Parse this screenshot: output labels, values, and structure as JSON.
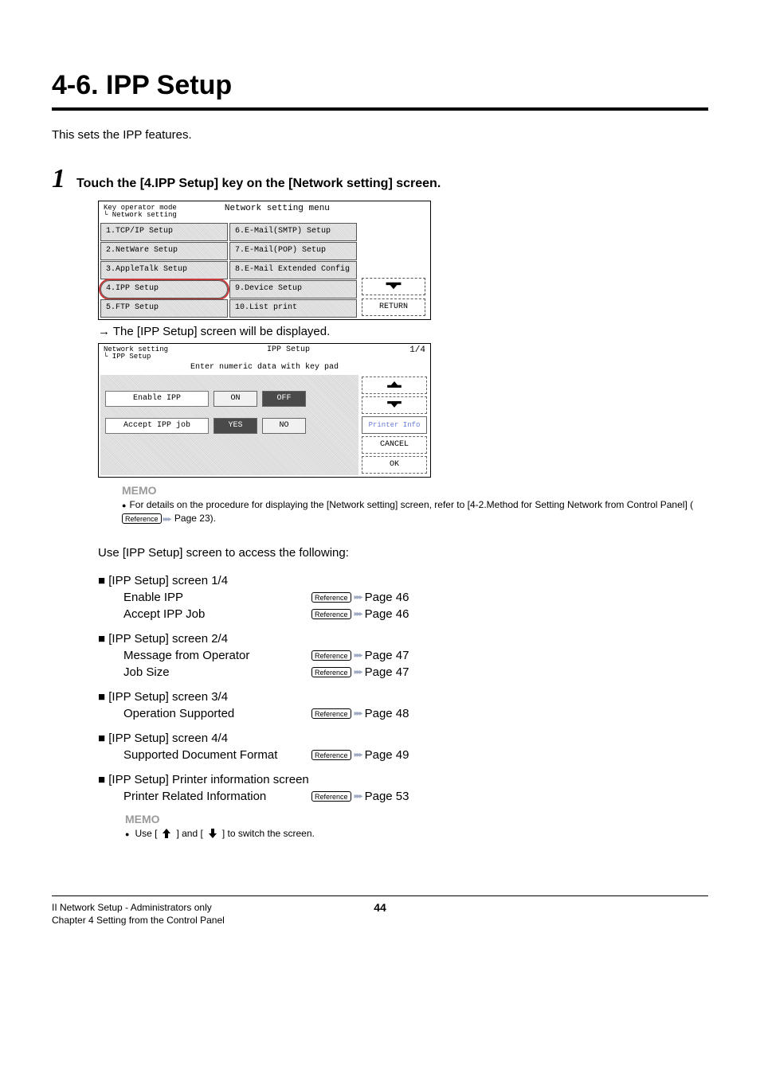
{
  "page": {
    "title": "4-6. IPP Setup",
    "intro": "This sets the IPP features.",
    "step1_num": "1",
    "step1_text": "Touch the [4.IPP Setup] key on the [Network setting] screen."
  },
  "panel1": {
    "breadcrumb1": "Key operator mode",
    "breadcrumb2": "└ Network setting",
    "title": "Network setting menu",
    "left": [
      "1.TCP/IP Setup",
      "2.NetWare Setup",
      "3.AppleTalk Setup",
      "4.IPP Setup",
      "5.FTP Setup"
    ],
    "right": [
      "6.E-Mail(SMTP) Setup",
      "7.E-Mail(POP) Setup",
      "8.E-Mail Extended Config",
      "9.Device Setup",
      "10.List print"
    ],
    "selected_index": 3,
    "return": "RETURN"
  },
  "result_line": "→ The [IPP Setup] screen will be displayed.",
  "panel2": {
    "breadcrumb1": "Network setting",
    "breadcrumb2": "└ IPP Setup",
    "title": "IPP Setup",
    "subtitle": "Enter numeric data with key pad",
    "page_ind": "1/4",
    "row1_label": "Enable IPP",
    "row1_on": "ON",
    "row1_off": "OFF",
    "row2_label": "Accept IPP job",
    "row2_yes": "YES",
    "row2_no": "NO",
    "printer_info": "Printer Info",
    "cancel": "CANCEL",
    "ok": "OK"
  },
  "memo1": {
    "heading": "MEMO",
    "text_a": "For details on the procedure for displaying the [Network setting] screen, refer to [4-2.Method for Setting Network from Control Panel] (",
    "ref": "Reference",
    "text_b": " Page 23)."
  },
  "use_text": "Use [IPP Setup] screen to access the following:",
  "groups": [
    {
      "heading": "[IPP Setup] screen 1/4",
      "rows": [
        {
          "label": "Enable IPP",
          "page": "Page 46"
        },
        {
          "label": "Accept IPP Job",
          "page": "Page 46"
        }
      ]
    },
    {
      "heading": "[IPP Setup] screen 2/4",
      "rows": [
        {
          "label": "Message from Operator",
          "page": "Page 47"
        },
        {
          "label": "Job Size",
          "page": "Page 47"
        }
      ]
    },
    {
      "heading": "[IPP Setup] screen 3/4",
      "rows": [
        {
          "label": "Operation Supported",
          "page": "Page 48"
        }
      ]
    },
    {
      "heading": "[IPP Setup] screen 4/4",
      "rows": [
        {
          "label": "Supported Document Format",
          "page": "Page 49"
        }
      ]
    },
    {
      "heading": "[IPP Setup] Printer information screen",
      "rows": [
        {
          "label": "Printer Related Information",
          "page": "Page 53"
        }
      ]
    }
  ],
  "ref_label": "Reference",
  "memo2": {
    "heading": "MEMO",
    "pre": "Use [",
    "mid": "] and [",
    "post": "] to switch the screen."
  },
  "footer": {
    "l1": "II Network Setup - Administrators only",
    "l2": "Chapter 4 Setting from the Control Panel",
    "page": "44"
  }
}
